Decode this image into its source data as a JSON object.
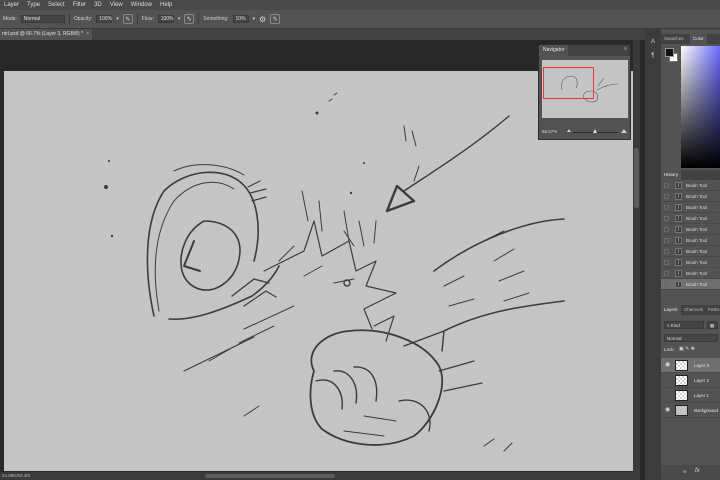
{
  "menu": [
    "Layer",
    "Type",
    "Select",
    "Filter",
    "3D",
    "View",
    "Window",
    "Help"
  ],
  "options": {
    "mode_label": "Mode:",
    "mode_value": "Normal",
    "opacity_label": "Opacity:",
    "opacity_value": "100%",
    "flow_label": "Flow:",
    "flow_value": "100%",
    "smoothing_label": "Smoothing:",
    "smoothing_value": "10%"
  },
  "document": {
    "tab_label": "ntrl.psd @ 66.7% (Layer 3, RGB/8) *",
    "close_glyph": "×"
  },
  "status": {
    "text": "24.89K/63.4M"
  },
  "navigator": {
    "title": "Navigator",
    "zoom": "66.67%"
  },
  "color_panel": {
    "tabs": [
      "Swatches",
      "Color"
    ],
    "active_tab": "Color",
    "foreground": "#101010",
    "background": "#ffffff"
  },
  "history": {
    "title": "History",
    "items": [
      "Brush Tool",
      "Brush Tool",
      "Brush Tool",
      "Brush Tool",
      "Brush Tool",
      "Brush Tool",
      "Brush Tool",
      "Brush Tool",
      "Brush Tool",
      "Brush Tool"
    ],
    "active_index": 9
  },
  "layers_panel": {
    "tabs": [
      "Layers",
      "Channels",
      "Paths"
    ],
    "filter": "Kind",
    "blend_mode": "Normal",
    "lock_label": "Lock:",
    "layers": [
      {
        "name": "Layer 3",
        "active": true
      },
      {
        "name": "Layer 2",
        "active": false
      },
      {
        "name": "Layer 1",
        "active": false
      },
      {
        "name": "Background",
        "active": false
      }
    ]
  },
  "colors": {
    "canvas": "#c4c4c4",
    "accent_red": "#e83a2e",
    "panel": "#535353"
  }
}
